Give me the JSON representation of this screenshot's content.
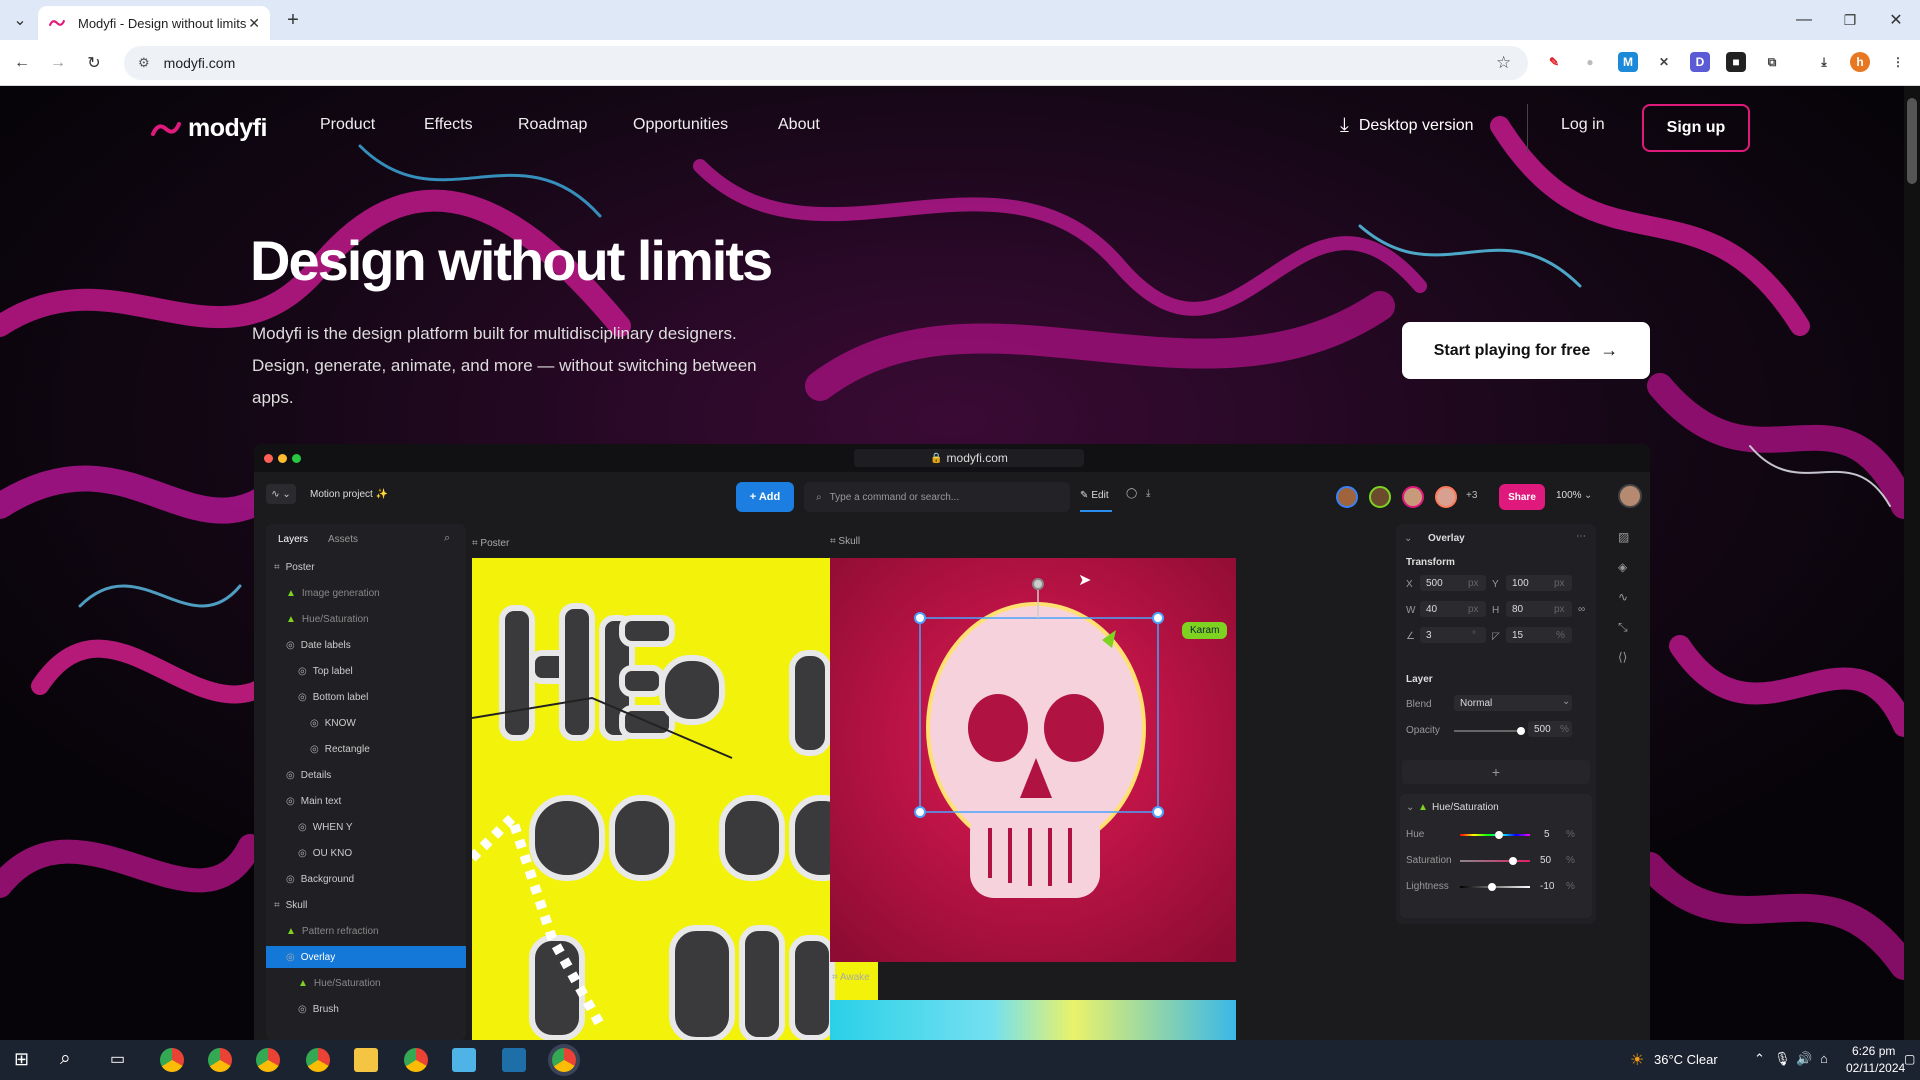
{
  "browser": {
    "tab_title": "Modyfi - Design without limits",
    "url": "modyfi.com"
  },
  "nav": {
    "brand": "modyfi",
    "links": [
      "Product",
      "Effects",
      "Roadmap",
      "Opportunities",
      "About"
    ],
    "desktop_version": "Desktop version",
    "login": "Log in",
    "signup": "Sign up"
  },
  "hero": {
    "title": "Design without limits",
    "subtitle": "Modyfi is the design platform built for multidisciplinary designers. Design, generate, animate, and more — without switching between apps.",
    "cta": "Start playing for free"
  },
  "app": {
    "url": "modyfi.com",
    "project_name": "Motion project ✨",
    "add_label": "+ Add",
    "search_placeholder": "Type a command or search...",
    "edit_label": "Edit",
    "extra_collaborators": "+3",
    "share_label": "Share",
    "zoom": "100%",
    "panel_tabs": [
      "Layers",
      "Assets"
    ],
    "layers": [
      {
        "label": "Poster",
        "indent": 0,
        "dim": false,
        "selected": false
      },
      {
        "label": "Image generation",
        "indent": 1,
        "dim": true,
        "selected": false
      },
      {
        "label": "Hue/Saturation",
        "indent": 1,
        "dim": true,
        "selected": false
      },
      {
        "label": "Date labels",
        "indent": 1,
        "dim": false,
        "selected": false
      },
      {
        "label": "Top label",
        "indent": 2,
        "dim": false,
        "selected": false
      },
      {
        "label": "Bottom label",
        "indent": 2,
        "dim": false,
        "selected": false
      },
      {
        "label": "KNOW",
        "indent": 3,
        "dim": false,
        "selected": false
      },
      {
        "label": "Rectangle",
        "indent": 3,
        "dim": false,
        "selected": false
      },
      {
        "label": "Details",
        "indent": 1,
        "dim": false,
        "selected": false
      },
      {
        "label": "Main text",
        "indent": 1,
        "dim": false,
        "selected": false
      },
      {
        "label": "WHEN Y",
        "indent": 2,
        "dim": false,
        "selected": false
      },
      {
        "label": "OU KNO",
        "indent": 2,
        "dim": false,
        "selected": false
      },
      {
        "label": "Background",
        "indent": 1,
        "dim": false,
        "selected": false
      },
      {
        "label": "Skull",
        "indent": 0,
        "dim": false,
        "selected": false
      },
      {
        "label": "Pattern refraction",
        "indent": 1,
        "dim": true,
        "selected": false
      },
      {
        "label": "Overlay",
        "indent": 1,
        "dim": false,
        "selected": true
      },
      {
        "label": "Hue/Saturation",
        "indent": 2,
        "dim": true,
        "selected": false
      },
      {
        "label": "Brush",
        "indent": 2,
        "dim": false,
        "selected": false
      }
    ],
    "frames": {
      "poster": "Poster",
      "skull": "Skull",
      "awake": "Awake"
    },
    "cursor_label": "Karam",
    "props": {
      "header": "Overlay",
      "transform_title": "Transform",
      "x_label": "X",
      "x": "500",
      "x_unit": "px",
      "y_label": "Y",
      "y": "100",
      "y_unit": "px",
      "w_label": "W",
      "w": "40",
      "w_unit": "px",
      "h_label": "H",
      "h": "80",
      "h_unit": "px",
      "angle": "3",
      "angle_unit": "°",
      "radius": "15",
      "radius_unit": "%",
      "layer_title": "Layer",
      "blend_label": "Blend",
      "blend": "Normal",
      "opacity_label": "Opacity",
      "opacity": "500",
      "opacity_unit": "%",
      "opacity_level": 0.95,
      "plus": "+"
    },
    "hue_panel": {
      "title": "Hue/Saturation",
      "hue_label": "Hue",
      "hue": "5",
      "hue_unit": "%",
      "hue_level": 0.55,
      "sat_label": "Saturation",
      "sat": "50",
      "sat_unit": "%",
      "sat_level": 0.75,
      "light_label": "Lightness",
      "light": "-10",
      "light_unit": "%",
      "light_level": 0.45
    }
  },
  "taskbar": {
    "weather": "36°C  Clear",
    "time": "6:26 pm",
    "date": "02/11/2024"
  },
  "colors": {
    "accent_pink": "#e0197c",
    "accent_blue": "#1378d8",
    "poster_yellow": "#f2f20a",
    "skull_red": "#d6154e"
  }
}
